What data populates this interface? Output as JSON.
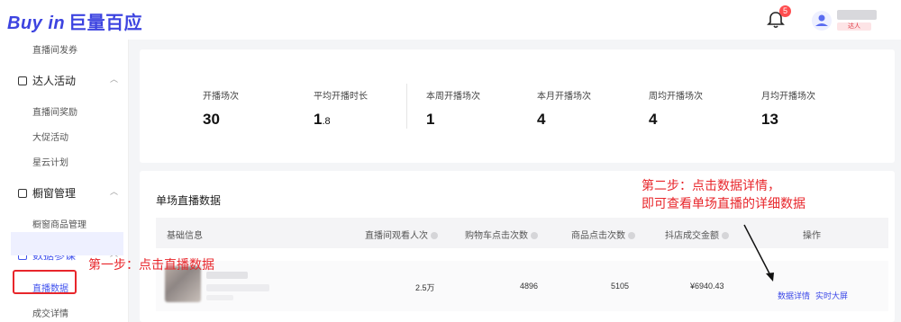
{
  "header": {
    "logo_text": "Buy in",
    "logo_cn": "巨量百应",
    "notification_count": "5",
    "user_tag": "达人"
  },
  "sidebar": {
    "top_sub": "直播间发券",
    "groups": [
      {
        "label": "达人活动",
        "items": [
          "直播间奖励",
          "大促活动",
          "星云计划"
        ]
      },
      {
        "label": "橱窗管理",
        "items": [
          "橱窗商品管理"
        ]
      },
      {
        "label": "数据参谋",
        "items": [
          "直播数据",
          "成交详情"
        ]
      }
    ]
  },
  "stats": [
    {
      "label": "开播场次",
      "value": "30"
    },
    {
      "label": "平均开播时长",
      "value": "1",
      "value_small": ".8"
    },
    {
      "label": "本周开播场次",
      "value": "1"
    },
    {
      "label": "本月开播场次",
      "value": "4"
    },
    {
      "label": "周均开播场次",
      "value": "4"
    },
    {
      "label": "月均开播场次",
      "value": "13"
    }
  ],
  "panel": {
    "title": "单场直播数据",
    "columns": [
      "基础信息",
      "直播间观看人次",
      "购物车点击次数",
      "商品点击次数",
      "抖店成交金额",
      "操作"
    ],
    "row": {
      "views": "2.5万",
      "cart_clicks": "4896",
      "product_clicks": "5105",
      "gmv": "¥6940.43"
    },
    "actions": [
      "数据详情",
      "实时大屏"
    ]
  },
  "annotations": {
    "step1": "第一步：点击直播数据",
    "step2_line1": "第二步：点击数据详情，",
    "step2_line2": "即可查看单场直播的详细数据"
  },
  "colors": {
    "brand": "#3d44e0",
    "annotation": "#e8262b",
    "link": "#3d4ae8"
  }
}
